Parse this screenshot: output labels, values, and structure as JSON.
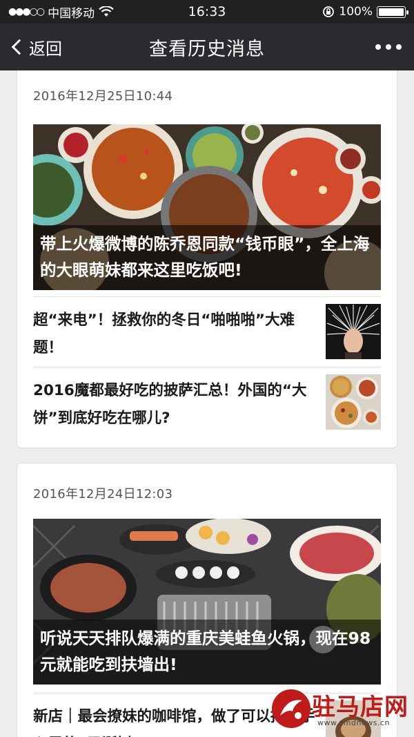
{
  "status_bar": {
    "signal_dots": "●●●○○",
    "carrier": "中国移动",
    "time": "16:33",
    "battery_text": "100%",
    "battery_level": 1.0
  },
  "nav": {
    "back_label": "返回",
    "title": "查看历史消息"
  },
  "messages": [
    {
      "date": "2016年12月25日10:44",
      "cover_title": "带上火爆微博的陈乔恩同款“钱币眼”，全上海的大眼萌妹都来这里吃饭吧!",
      "items": [
        {
          "title": "超“来电”！拯救你的冬日“啪啪啪”大难题！"
        },
        {
          "title": "2016魔都最好吃的披萨汇总！外国的“大饼”到底好吃在哪儿?"
        }
      ]
    },
    {
      "date": "2016年12月24日12:03",
      "cover_title": "听说天天排队爆满的重庆美蛙鱼火锅，现在98元就能吃到扶墙出!",
      "items": [
        {
          "title": "新店｜最会撩妹的咖啡馆，做了可以捧在手心里的“圣诞树”"
        }
      ]
    }
  ],
  "watermark": {
    "text": "驻马店网",
    "url": "www.zmdnews.cn"
  },
  "colors": {
    "status_bar": "#212121",
    "nav_bar": "#2b2b2f",
    "background": "#ededed",
    "watermark_red": "#c01b1b"
  }
}
